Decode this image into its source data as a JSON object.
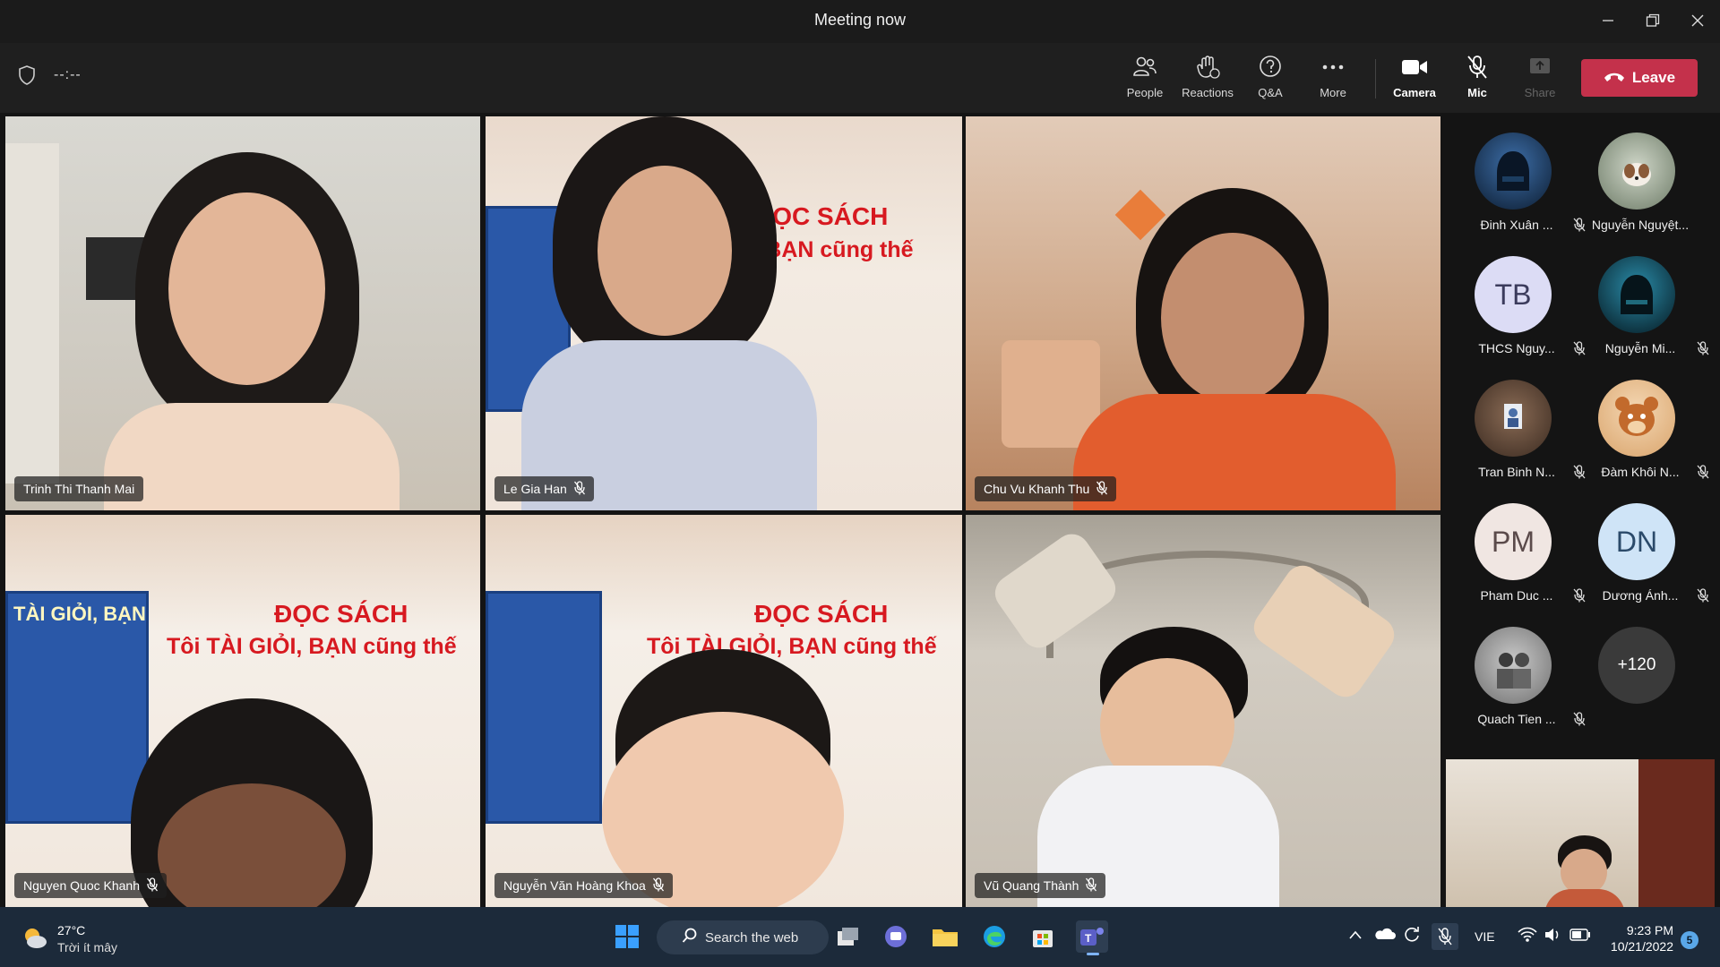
{
  "window": {
    "title": "Meeting now"
  },
  "toolbar": {
    "timer": "--:--",
    "people_label": "People",
    "reactions_label": "Reactions",
    "qa_label": "Q&A",
    "more_label": "More",
    "camera_label": "Camera",
    "mic_label": "Mic",
    "share_label": "Share",
    "leave_label": "Leave"
  },
  "tiles": [
    {
      "name": "Trinh Thi Thanh Mai"
    },
    {
      "name": "Le Gia Han"
    },
    {
      "name": "Chu Vu Khanh Thu"
    },
    {
      "name": "Nguyen Quoc Khanh"
    },
    {
      "name": "Nguyễn Văn Hoàng Khoa"
    },
    {
      "name": "Vũ Quang Thành"
    }
  ],
  "poster": {
    "title": "ĐỌC SÁCH",
    "subtitle": "Tôi TÀI GIỎI, BẠN cũng thế",
    "subtitle_short": "ỎI, BẠN cũng thế",
    "book_text": "TÀI GIỎI, BẠN"
  },
  "roster": [
    {
      "name": "Đinh Xuân ...",
      "initials": ""
    },
    {
      "name": "Nguyễn Nguyệt...",
      "initials": ""
    },
    {
      "name": "THCS Nguy...",
      "initials": "TB"
    },
    {
      "name": "Nguyễn Mi...",
      "initials": ""
    },
    {
      "name": "Tran Binh N...",
      "initials": ""
    },
    {
      "name": "Đàm Khôi N...",
      "initials": ""
    },
    {
      "name": "Pham Duc ...",
      "initials": "PM"
    },
    {
      "name": "Dương Ánh...",
      "initials": "DN"
    },
    {
      "name": "Quach Tien ...",
      "initials": ""
    },
    {
      "name": "",
      "initials": "+120"
    }
  ],
  "taskbar": {
    "temp": "27°C",
    "weather": "Trời ít mây",
    "search_label": "Search the web",
    "lang": "VIE",
    "time": "9:23 PM",
    "date": "10/21/2022",
    "notifications": "5"
  },
  "colors": {
    "leave": "#c4314b",
    "active_outline": "#7f85f5",
    "accent": "#6264a7"
  }
}
